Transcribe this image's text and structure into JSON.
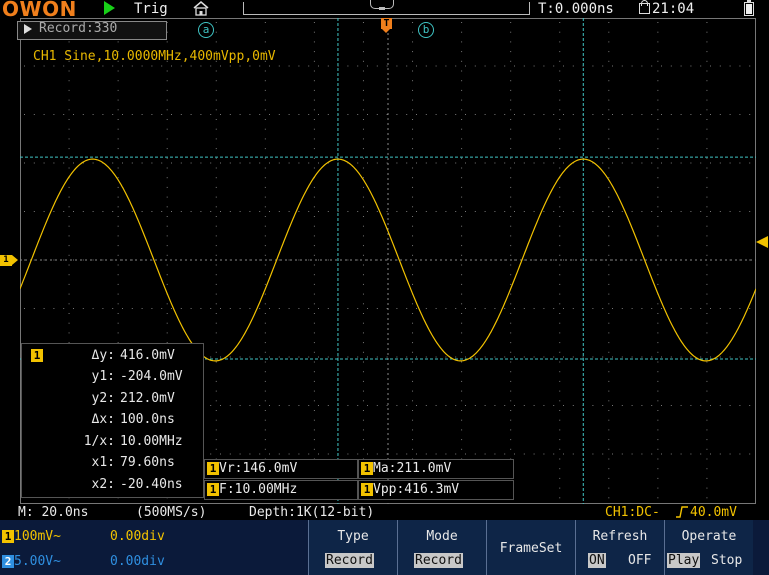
{
  "topbar": {
    "logo": "OWON",
    "run_state": "Trig",
    "time_offset": "T:0.000ns",
    "clock": "21:04"
  },
  "record_box": {
    "label": "Record:330"
  },
  "cursor_markers": {
    "a": "a",
    "b": "b",
    "trigger": "T"
  },
  "signal_label": "CH1 Sine,10.0000MHz,400mVpp,0mV",
  "cursor_table": {
    "channel": "1",
    "rows": [
      {
        "key": "Δy:",
        "value": "416.0mV"
      },
      {
        "key": "y1:",
        "value": "-204.0mV"
      },
      {
        "key": "y2:",
        "value": "212.0mV"
      },
      {
        "key": "Δx:",
        "value": "100.0ns"
      },
      {
        "key": "1/x:",
        "value": "10.00MHz"
      },
      {
        "key": "x1:",
        "value": "79.60ns"
      },
      {
        "key": "x2:",
        "value": "-20.40ns"
      }
    ]
  },
  "measurements": [
    {
      "channel": "1",
      "text": "Vr:146.0mV"
    },
    {
      "channel": "1",
      "text": "Ma:211.0mV"
    },
    {
      "channel": "1",
      "text": "F:10.00MHz"
    },
    {
      "channel": "1",
      "text": "Vpp:416.3mV"
    }
  ],
  "status": {
    "timebase": "M: 20.0ns",
    "sample_rate": "(500MS/s)",
    "depth": "Depth:1K(12-bit)",
    "trigger": "CH1:DC-",
    "trigger_level": "40.0mV"
  },
  "channels": [
    {
      "num": "1",
      "scale": "100mV~",
      "offset": "0.00div",
      "color": "#f2c200"
    },
    {
      "num": "2",
      "scale": "5.00V~",
      "offset": "0.00div",
      "color": "#2f8fe0"
    }
  ],
  "menu": {
    "type": {
      "title": "Type",
      "value": "Record"
    },
    "mode": {
      "title": "Mode",
      "value": "Record"
    },
    "frameset": {
      "title": "FrameSet"
    },
    "refresh": {
      "title": "Refresh",
      "on": "ON",
      "off": "OFF"
    },
    "operate": {
      "title": "Operate",
      "play": "Play",
      "stop": "Stop"
    }
  },
  "colors": {
    "ch1": "#f2c200",
    "ch2": "#2f8fe0",
    "cursor": "#3fc4c4",
    "accent": "#f07f1c"
  },
  "waveform": {
    "frequency_hz": 10000000,
    "amplitude_mvpp": 416.0,
    "offset_mv": 0,
    "cursor_y1_mv": -204.0,
    "cursor_y2_mv": 212.0,
    "cursor_x1_ns": 79.6,
    "cursor_x2_ns": -20.4
  }
}
